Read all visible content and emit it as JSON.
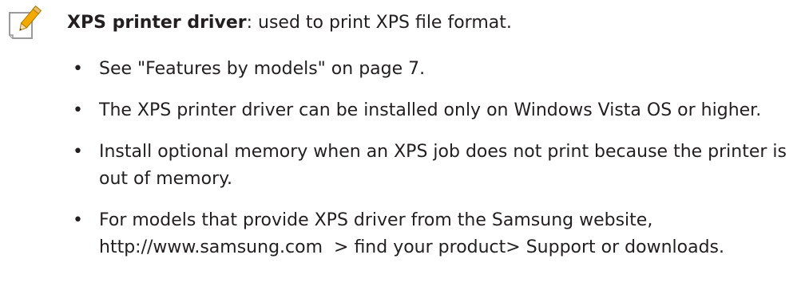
{
  "note": {
    "icon": "note-pencil-icon",
    "term": "XPS printer driver",
    "description": ": used to print XPS file format."
  },
  "bullets": [
    {
      "text": "See \"Features by models\" on page 7."
    },
    {
      "text": "The XPS printer driver can be installed only on Windows Vista OS or higher."
    },
    {
      "text": "Install optional memory when an XPS job does not print because the printer is out of memory."
    },
    {
      "text_before": "For models that provide XPS driver from the Samsung website, ",
      "link": "http://www.samsung.com",
      "text_after": "  > find your product> Support or downloads."
    }
  ],
  "bullet_glyph": "•"
}
